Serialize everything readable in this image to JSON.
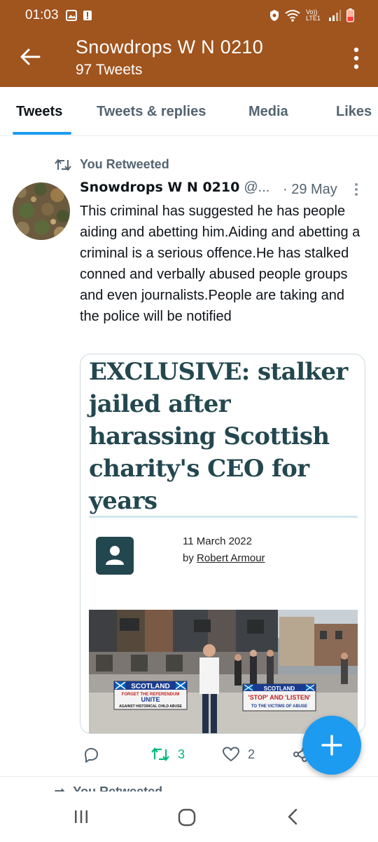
{
  "status_bar": {
    "time": "01:03",
    "icons": [
      "image-icon",
      "alert-icon",
      "vpn-icon",
      "wifi-icon",
      "volte-icon",
      "signal-icon",
      "battery-icon"
    ],
    "volte_label": "Vo)) LTE1"
  },
  "header": {
    "title": "Snowdrops W N 0210",
    "subtitle": "97 Tweets",
    "background_color": "#a0541e"
  },
  "tabs": [
    {
      "label": "Tweets",
      "active": true
    },
    {
      "label": "Tweets & replies",
      "active": false
    },
    {
      "label": "Media",
      "active": false
    },
    {
      "label": "Likes",
      "active": false
    }
  ],
  "tweet": {
    "retweet_label": "You Retweeted",
    "author_name": "Snowdrops W N 0210",
    "author_handle": "@...",
    "date": "· 29 May",
    "text": "This criminal has suggested he has people aiding and abetting him.Aiding and abetting a criminal is a serious offence.He has stalked conned and verbally abused people groups and even journalists.People are taking and the police will be notified",
    "card": {
      "headline": "EXCLUSIVE: stalker jailed after harassing Scottish charity's CEO for years",
      "date": "11 March 2022",
      "byline_prefix": "by",
      "byline_author": "Robert Armour",
      "banner_left": {
        "line1": "SCOTLAND",
        "line2": "FORGET THE REFERENDUM",
        "line3": "UNITE",
        "line4": "AGAINST HISTORICAL CHILD ABUSE"
      },
      "banner_right": {
        "line1": "SCOTLAND",
        "line2": "'STOP' AND 'LISTEN'",
        "line3": "TO THE VICTIMS OF ABUSE"
      }
    },
    "actions": {
      "reply_count": "",
      "retweet_count": "3",
      "like_count": "2"
    }
  },
  "next_tweet_retweet_label": "You Retweeted",
  "colors": {
    "accent": "#1d9bf0",
    "retweet_green": "#00ba7c",
    "text_secondary": "#536471"
  }
}
